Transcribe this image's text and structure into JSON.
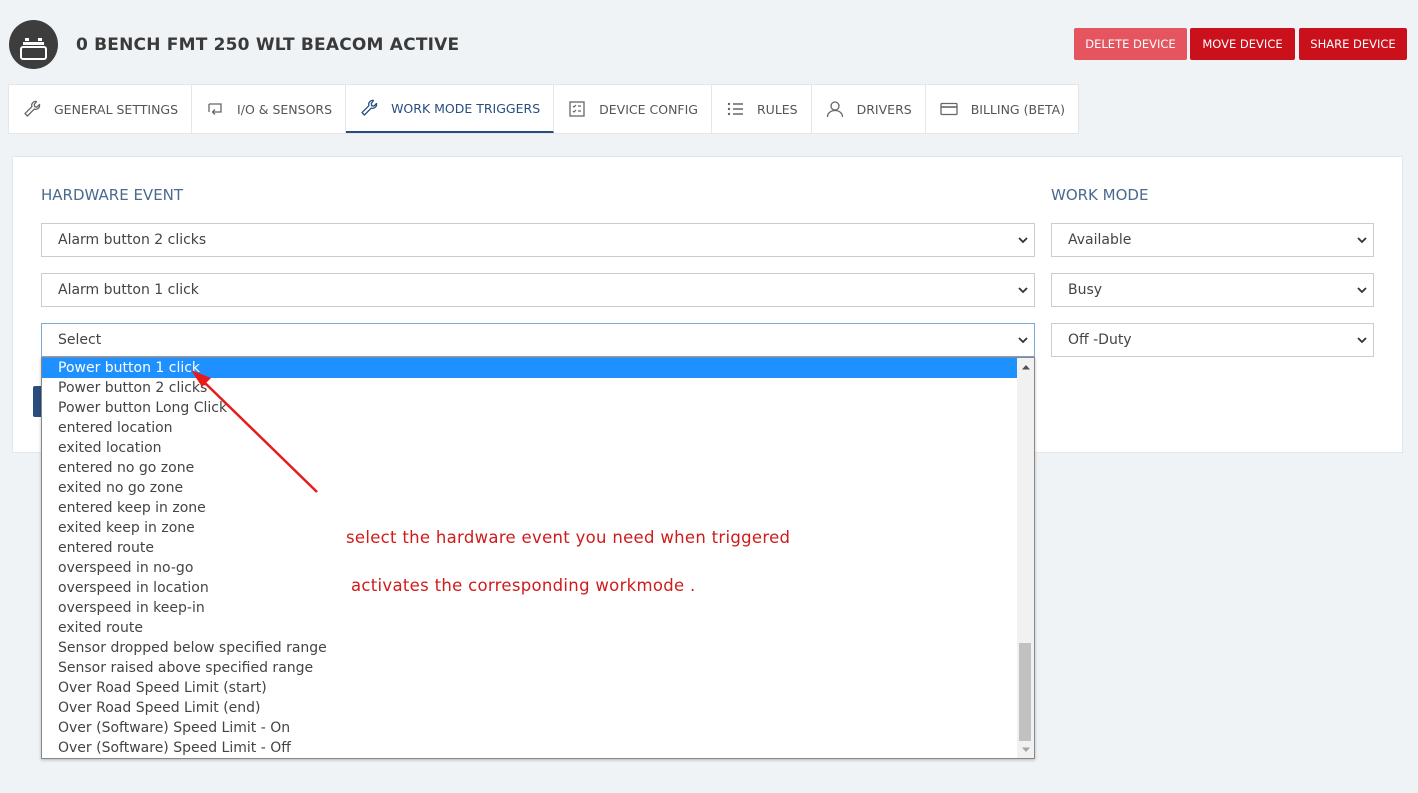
{
  "device": {
    "title": "0 BENCH FMT 250 WLT BEACOM ACTIVE"
  },
  "actions": {
    "delete": "DELETE DEVICE",
    "move": "MOVE DEVICE",
    "share": "SHARE DEVICE"
  },
  "tabs": [
    {
      "label": "GENERAL SETTINGS",
      "icon": "wrench-icon"
    },
    {
      "label": "I/O & SENSORS",
      "icon": "io-arrows-icon"
    },
    {
      "label": "WORK MODE TRIGGERS",
      "icon": "wrench-icon",
      "active": true
    },
    {
      "label": "DEVICE CONFIG",
      "icon": "config-checklist-icon"
    },
    {
      "label": "RULES",
      "icon": "list-icon"
    },
    {
      "label": "DRIVERS",
      "icon": "user-icon"
    },
    {
      "label": "BILLING (BETA)",
      "icon": "credit-card-icon"
    }
  ],
  "form": {
    "hardware_label": "HARDWARE EVENT",
    "workmode_label": "WORK MODE",
    "rows": [
      {
        "hardware": "Alarm button 2 clicks",
        "workmode": "Available"
      },
      {
        "hardware": "Alarm button 1 click",
        "workmode": "Busy"
      },
      {
        "hardware": "Select",
        "workmode": "Off -Duty"
      }
    ]
  },
  "dropdown": {
    "highlighted": "Power button 1 click",
    "options": [
      "Power button 1 click",
      "Power button 2 clicks",
      "Power button Long Click",
      "entered location",
      "exited location",
      "entered no go zone",
      "exited no go zone",
      "entered keep in zone",
      "exited keep in zone",
      "entered route",
      "overspeed in no-go",
      "overspeed in location",
      "overspeed in keep-in",
      "exited route",
      "Sensor dropped below specified range",
      "Sensor raised above specified range",
      "Over Road Speed Limit (start)",
      "Over Road Speed Limit (end)",
      "Over (Software) Speed Limit - On",
      "Over (Software) Speed Limit - Off"
    ]
  },
  "annotation": {
    "line1": "select the hardware event you need when triggered",
    "line2": "activates the corresponding workmode ."
  },
  "colors": {
    "accent": "#2a4d80",
    "danger": "#c9101b",
    "danger_light": "#e4555f",
    "highlight": "#1e90ff",
    "annotation": "#d01b1b"
  }
}
